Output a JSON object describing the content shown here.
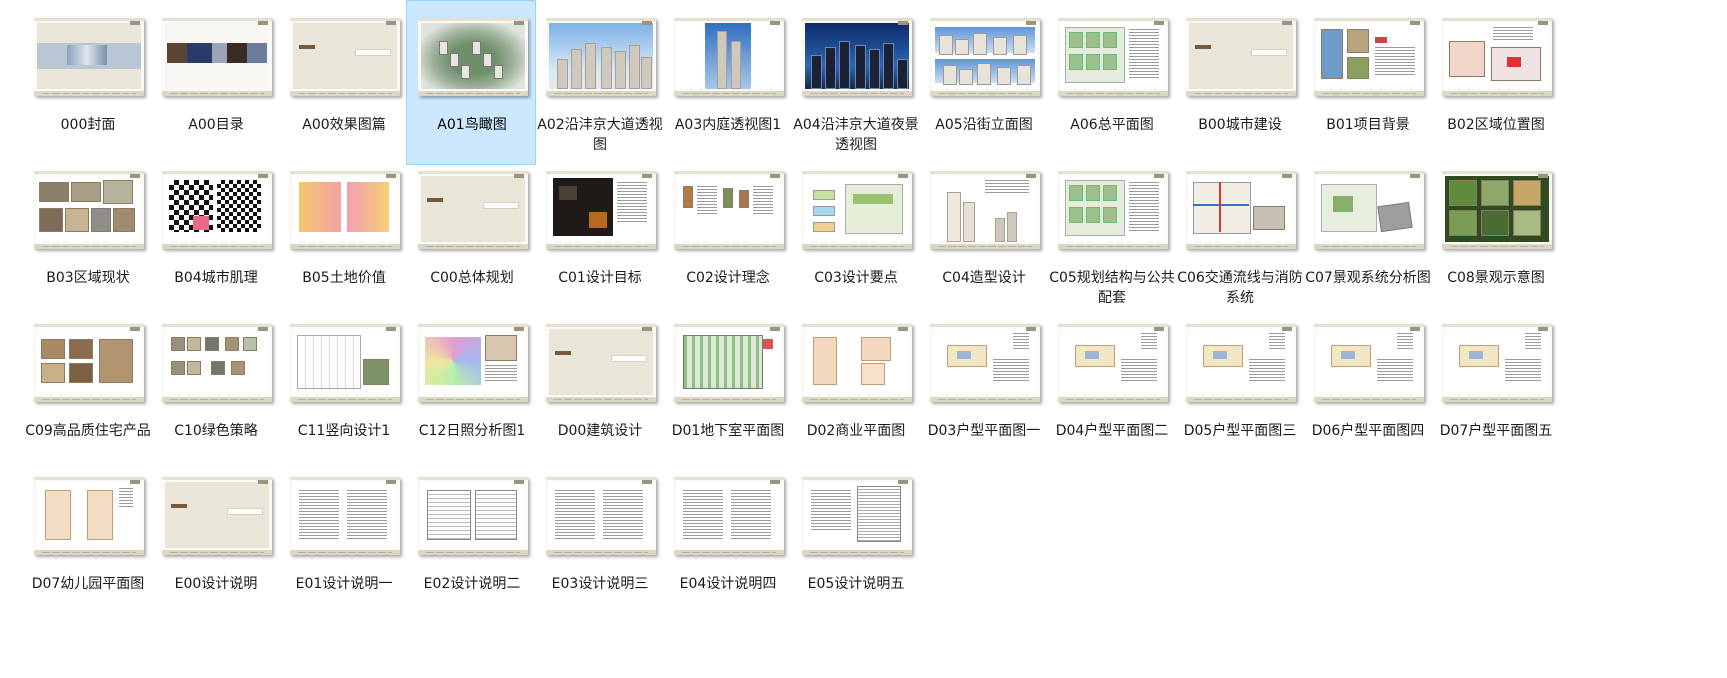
{
  "window": {
    "view": "large-icons",
    "selected": "A01鸟瞰图"
  },
  "files": [
    {
      "name": "000封面",
      "thumb": "cover",
      "selected": false
    },
    {
      "name": "A00目录",
      "thumb": "banner",
      "selected": false
    },
    {
      "name": "A00效果图篇",
      "thumb": "section",
      "selected": false
    },
    {
      "name": "A01鸟瞰图",
      "thumb": "aerial",
      "selected": true
    },
    {
      "name": "A02沿沣京大道透视图",
      "thumb": "street",
      "selected": false
    },
    {
      "name": "A03内庭透视图1",
      "thumb": "tower",
      "selected": false
    },
    {
      "name": "A04沿沣京大道夜景透视图",
      "thumb": "night",
      "selected": false
    },
    {
      "name": "A05沿街立面图",
      "thumb": "elevation",
      "selected": false
    },
    {
      "name": "A06总平面图",
      "thumb": "siteplan",
      "selected": false
    },
    {
      "name": "B00城市建设",
      "thumb": "section",
      "selected": false
    },
    {
      "name": "B01项目背景",
      "thumb": "collage",
      "selected": false
    },
    {
      "name": "B02区域位置图",
      "thumb": "map",
      "selected": false
    },
    {
      "name": "B03区域现状",
      "thumb": "photos",
      "selected": false
    },
    {
      "name": "B04城市肌理",
      "thumb": "fabric",
      "selected": false
    },
    {
      "name": "B05土地价值",
      "thumb": "landvalue",
      "selected": false
    },
    {
      "name": "C00总体规划",
      "thumb": "section",
      "selected": false
    },
    {
      "name": "C01设计目标",
      "thumb": "dark",
      "selected": false
    },
    {
      "name": "C02设计理念",
      "thumb": "concept",
      "selected": false
    },
    {
      "name": "C03设计要点",
      "thumb": "diagram",
      "selected": false
    },
    {
      "name": "C04造型设计",
      "thumb": "form",
      "selected": false
    },
    {
      "name": "C05规划结构与公共配套",
      "thumb": "siteplan",
      "selected": false
    },
    {
      "name": "C06交通流线与消防系统",
      "thumb": "traffic",
      "selected": false
    },
    {
      "name": "C07景观系统分析图",
      "thumb": "landscape",
      "selected": false
    },
    {
      "name": "C08景观示意图",
      "thumb": "landscape2",
      "selected": false
    },
    {
      "name": "C09高品质住宅产品",
      "thumb": "interior",
      "selected": false
    },
    {
      "name": "C10绿色策略",
      "thumb": "green",
      "selected": false
    },
    {
      "name": "C11竖向设计1",
      "thumb": "vertical",
      "selected": false
    },
    {
      "name": "C12日照分析图1",
      "thumb": "sun",
      "selected": false
    },
    {
      "name": "D00建筑设计",
      "thumb": "section",
      "selected": false
    },
    {
      "name": "D01地下室平面图",
      "thumb": "basement",
      "selected": false
    },
    {
      "name": "D02商业平面图",
      "thumb": "commercial",
      "selected": false
    },
    {
      "name": "D03户型平面图一",
      "thumb": "unit",
      "selected": false
    },
    {
      "name": "D04户型平面图二",
      "thumb": "unit",
      "selected": false
    },
    {
      "name": "D05户型平面图三",
      "thumb": "unit",
      "selected": false
    },
    {
      "name": "D06户型平面图四",
      "thumb": "unit",
      "selected": false
    },
    {
      "name": "D07户型平面图五",
      "thumb": "unit",
      "selected": false
    },
    {
      "name": "D07幼儿园平面图",
      "thumb": "kinder",
      "selected": false
    },
    {
      "name": "E00设计说明",
      "thumb": "section",
      "selected": false
    },
    {
      "name": "E01设计说明一",
      "thumb": "text",
      "selected": false
    },
    {
      "name": "E02设计说明二",
      "thumb": "table",
      "selected": false
    },
    {
      "name": "E03设计说明三",
      "thumb": "text",
      "selected": false
    },
    {
      "name": "E04设计说明四",
      "thumb": "text",
      "selected": false
    },
    {
      "name": "E05设计说明五",
      "thumb": "table2",
      "selected": false
    }
  ],
  "colors": {
    "selection_bg": "#cce8ff",
    "selection_border": "#99d1ff",
    "text": "#1a1a1a",
    "page_beige": "#e9e5d9"
  }
}
